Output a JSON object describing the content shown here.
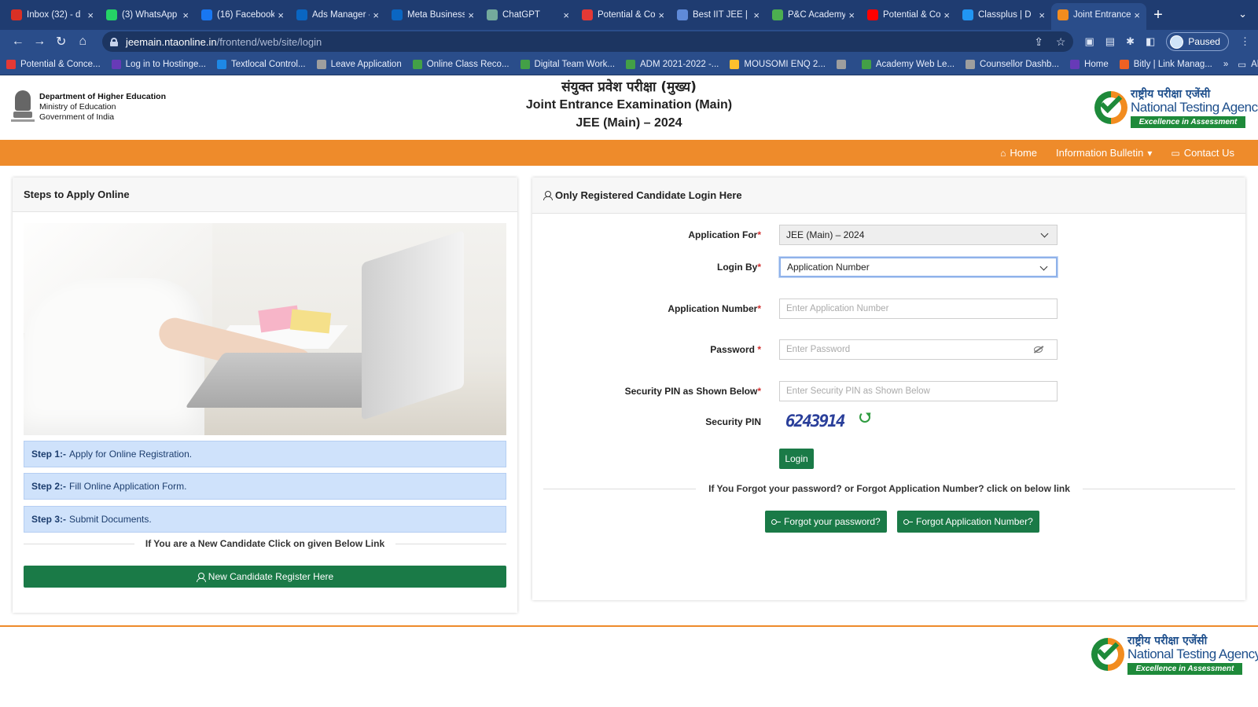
{
  "browser": {
    "tabs": [
      {
        "label": "Inbox (32) - d",
        "favicon": "gmail-icon",
        "color": "#d93025"
      },
      {
        "label": "(3) WhatsApp",
        "favicon": "whatsapp-icon",
        "color": "#25d366"
      },
      {
        "label": "(16) Facebook",
        "favicon": "facebook-icon",
        "color": "#1877f2"
      },
      {
        "label": "Ads Manager -",
        "favicon": "meta-icon",
        "color": "#0a66c2"
      },
      {
        "label": "Meta Business",
        "favicon": "meta-icon",
        "color": "#0a66c2"
      },
      {
        "label": "ChatGPT",
        "favicon": "chatgpt-icon",
        "color": "#74aa9c"
      },
      {
        "label": "Potential & Co",
        "favicon": "potential-icon",
        "color": "#e53935"
      },
      {
        "label": "Best IIT JEE |",
        "favicon": "globe-icon",
        "color": "#5f8ad8"
      },
      {
        "label": "P&C Academy",
        "favicon": "pc-icon",
        "color": "#4caf50"
      },
      {
        "label": "Potential & Co",
        "favicon": "youtube-icon",
        "color": "#ff0000"
      },
      {
        "label": "Classplus | D",
        "favicon": "classplus-icon",
        "color": "#2196f3"
      },
      {
        "label": "Joint Entrance",
        "favicon": "nta-icon",
        "color": "#f28c1f"
      }
    ],
    "new_tab": "+",
    "url_host": "jeemain.ntaonline.in",
    "url_path": "/frontend/web/site/login",
    "profile_status": "Paused",
    "bookmarks": [
      {
        "label": "Potential & Conce...",
        "color": "#e53935"
      },
      {
        "label": "Log in to Hostinge...",
        "color": "#673ab7"
      },
      {
        "label": "Textlocal Control...",
        "color": "#1e88e5"
      },
      {
        "label": "Leave Application",
        "color": "#9e9e9e"
      },
      {
        "label": "Online Class Reco...",
        "color": "#43a047"
      },
      {
        "label": "Digital Team Work...",
        "color": "#43a047"
      },
      {
        "label": "ADM 2021-2022 -...",
        "color": "#43a047"
      },
      {
        "label": "MOUSOMI ENQ 2...",
        "color": "#fbc02d"
      },
      {
        "label": "",
        "color": "#9e9e9e"
      },
      {
        "label": "Academy Web Le...",
        "color": "#43a047"
      },
      {
        "label": "Counsellor Dashb...",
        "color": "#9e9e9e"
      },
      {
        "label": "Home",
        "color": "#673ab7"
      },
      {
        "label": "Bitly | Link Manag...",
        "color": "#ee6123"
      }
    ],
    "bookmarks_more": "»",
    "all_bookmarks": "All Bookmarks"
  },
  "header": {
    "dept_line1": "Department of Higher Education",
    "dept_line2": "Ministry of Education",
    "dept_line3": "Government of India",
    "title_hindi": "संयुक्त प्रवेश परीक्षा (मुख्य)",
    "title_en": "Joint Entrance Examination (Main)",
    "title_year": "JEE (Main) – 2024",
    "nta_hindi": "राष्ट्रीय परीक्षा एजेंसी",
    "nta_english": "National Testing Agency",
    "nta_tagline": "Excellence in Assessment"
  },
  "nav": {
    "home": "Home",
    "info_bulletin": "Information Bulletin",
    "contact": "Contact Us"
  },
  "left": {
    "heading": "Steps to Apply Online",
    "steps": [
      {
        "num": "Step 1:-",
        "text": "Apply for Online Registration."
      },
      {
        "num": "Step 2:-",
        "text": "Fill Online Application Form."
      },
      {
        "num": "Step 3:-",
        "text": "Submit Documents."
      }
    ],
    "new_candidate_text": "If You are a New Candidate Click on given Below Link",
    "register_button": "New Candidate Register Here"
  },
  "login": {
    "heading": "Only Registered Candidate Login Here",
    "application_for_label": "Application For",
    "application_for_value": "JEE (Main) – 2024",
    "login_by_label": "Login By",
    "login_by_value": "Application Number",
    "app_number_label": "Application Number",
    "app_number_placeholder": "Enter Application Number",
    "password_label": "Password",
    "password_placeholder": "Enter Password",
    "pin_label": "Security PIN as Shown Below",
    "pin_placeholder": "Enter Security PIN as Shown Below",
    "captcha_label": "Security PIN",
    "captcha_value": "6243914",
    "login_button": "Login",
    "forgot_text": "If You Forgot your password? or Forgot Application Number? click on below link",
    "forgot_password_button": "Forgot your password?",
    "forgot_appno_button": "Forgot Application Number?",
    "required_mark": "*"
  },
  "colors": {
    "nav_orange": "#ee8b2b",
    "primary_green": "#1a7a47",
    "step_blue": "#cfe2fb",
    "browser_blue": "#2a4d8a"
  }
}
